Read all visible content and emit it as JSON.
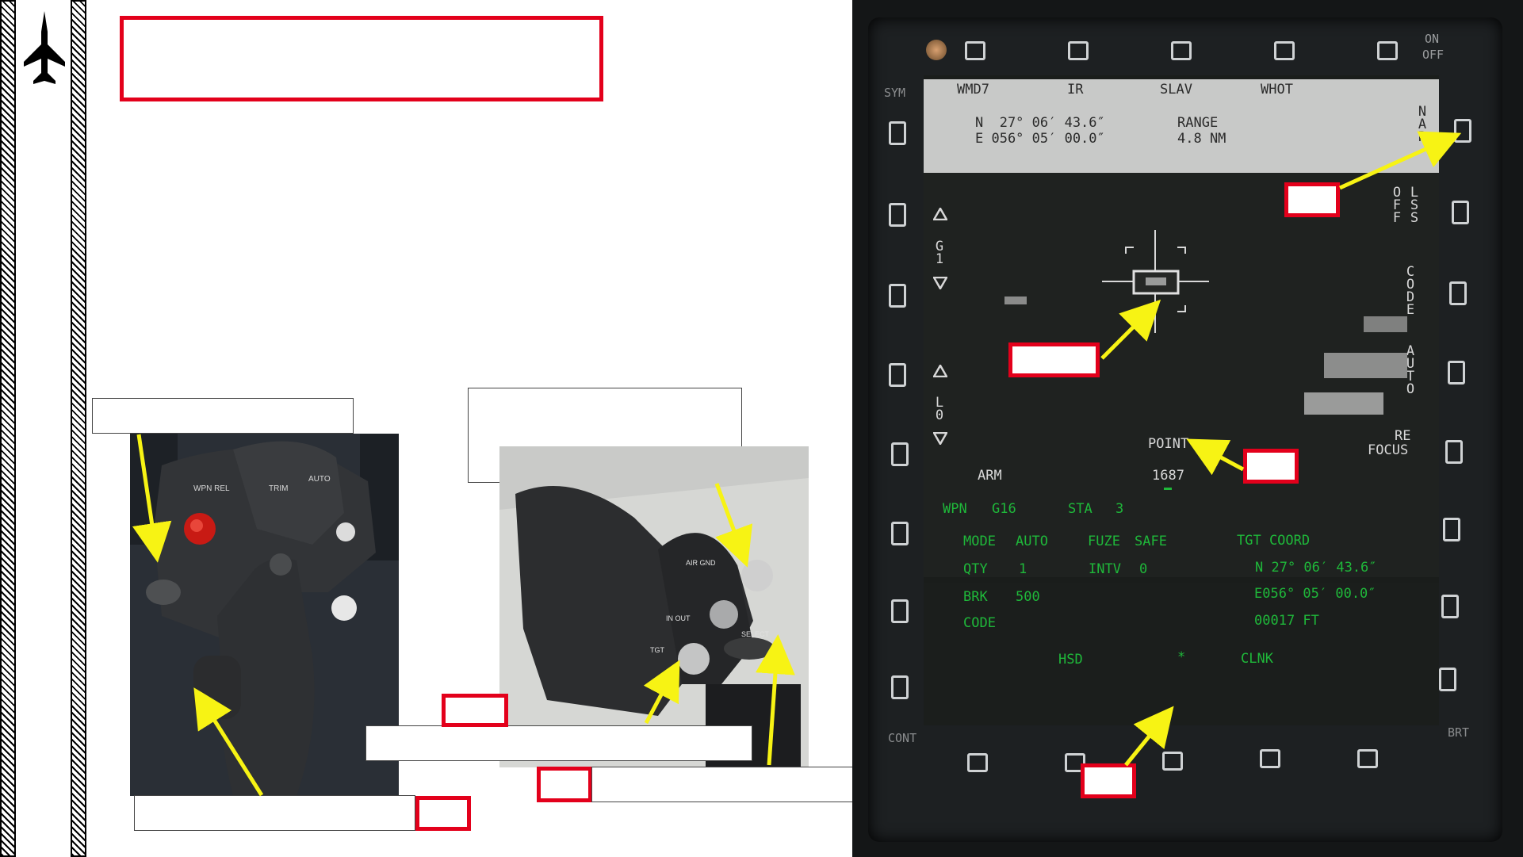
{
  "mfd": {
    "top_osb_labels": [
      "WMD7",
      "IR",
      "SLAV",
      "WHOT"
    ],
    "on_off": [
      "ON",
      "OFF"
    ],
    "sym": "SYM",
    "cont": "CONT",
    "brt": "BRT",
    "coord_lines": [
      "N  27° 06′ 43.6″",
      "E 056° 05′ 00.0″"
    ],
    "range_lines": [
      "RANGE",
      "4.8 NM"
    ],
    "nar": "NAR",
    "off": "OFF",
    "lss": "LSS",
    "code_side": "CODE",
    "auto_side": "AUTO",
    "refocus": [
      "RE",
      "FOCUS"
    ],
    "g1": "G1",
    "l0": "L0",
    "point": "POINT",
    "arm": "ARM",
    "laser_code": "1687",
    "wpn_label": "WPN",
    "wpn_value": "G16",
    "sta_label": "STA",
    "sta_value": "3",
    "mode_label": "MODE",
    "mode_value": "AUTO",
    "fuze_label": "FUZE",
    "fuze_value": "SAFE",
    "tgt_coord_label": "TGT COORD",
    "qty_label": "QTY",
    "qty_value": "1",
    "intv_label": "INTV",
    "intv_value": "0",
    "tgt_lat": "N 27° 06′ 43.6″",
    "brk_label": "BRK",
    "brk_value": "500",
    "tgt_lon": "E056° 05′ 00.0″",
    "code_label": "CODE",
    "tgt_alt": "00017 FT",
    "hsd": "HSD",
    "star": "*",
    "clnk": "CLNK",
    "colors": {
      "mfd_green": "#1fb83a",
      "callout_red": "#e3001b",
      "arrow_yellow": "#f7f314"
    }
  },
  "throttle": {
    "labels": [
      "WPN REL",
      "TRIM",
      "AUTO"
    ]
  },
  "stick": {
    "labels": [
      "IN OUT",
      "AIR GND",
      "TGT",
      "SELECT"
    ]
  },
  "icons": [
    "jet-icon",
    "knob-icon"
  ]
}
